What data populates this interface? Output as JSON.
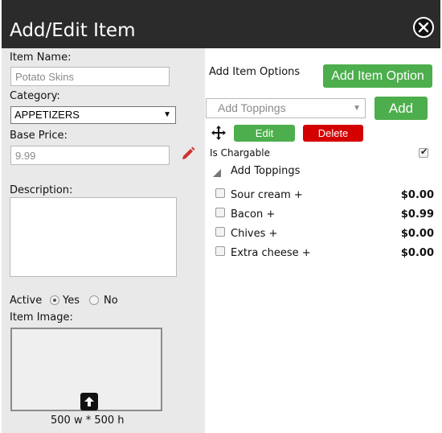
{
  "dialog": {
    "title": "Add/Edit Item"
  },
  "form": {
    "item_name_label": "Item Name:",
    "item_name_placeholder": "Potato Skins",
    "category_label": "Category:",
    "category_value": "APPETIZERS",
    "base_price_label": "Base Price:",
    "base_price_placeholder": "9.99",
    "description_label": "Description:",
    "active_label": "Active",
    "active_yes": "Yes",
    "active_no": "No",
    "active_selected": "Yes",
    "item_image_label": "Item Image:",
    "image_size_hint": "500 w * 500 h"
  },
  "options": {
    "header": "Add Item Options",
    "add_option_button": "Add Item Option",
    "select_placeholder": "Add Toppings",
    "add_button": "Add",
    "edit_button": "Edit",
    "delete_button": "Delete",
    "is_chargable_label": "Is Chargable",
    "is_chargable_checked": true,
    "group_title": "Add Toppings",
    "items": [
      {
        "name": "Sour cream +",
        "price": "$0.00"
      },
      {
        "name": "Bacon +",
        "price": "$0.99"
      },
      {
        "name": "Chives +",
        "price": "$0.00"
      },
      {
        "name": "Extra cheese +",
        "price": "$0.00"
      }
    ]
  },
  "colors": {
    "titlebar": "#2b2b2b",
    "green": "#4cae4c",
    "red": "#d40000",
    "pencil": "#d32f2f"
  },
  "icons": [
    "close-icon",
    "pencil-icon",
    "move-icon",
    "collapse-triangle-icon",
    "upload-arrow-icon"
  ]
}
